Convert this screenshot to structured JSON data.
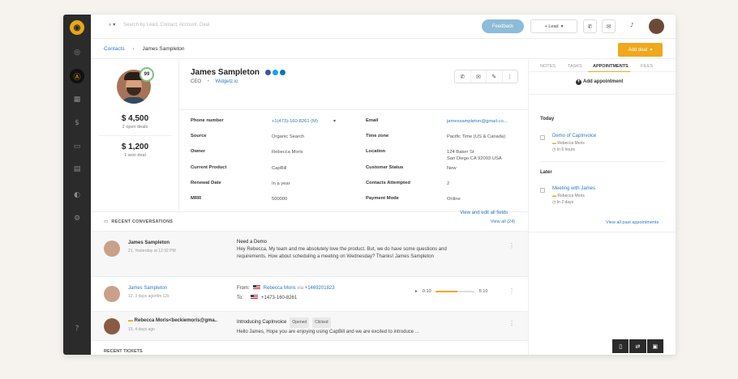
{
  "search": {
    "placeholder": "Search by Lead, Contact, Account, Deal"
  },
  "topbar": {
    "feedback_label": "Feedback",
    "add_lead_label": "+ Lead"
  },
  "breadcrumb": {
    "parent": "Contacts",
    "current": "James Sampleton"
  },
  "add_deal_label": "Add deal",
  "contact": {
    "score": "99",
    "revenue": "$ 4,500",
    "open_deals": "2 open deals",
    "won": "$ 1,200",
    "won_deals": "1 won deal",
    "name": "James Sampleton",
    "role": "CEO",
    "company": "Widgetz.io"
  },
  "fields_left": [
    {
      "label": "Phone number",
      "value": "+1(473)-160-8261 (M)"
    },
    {
      "label": "Source",
      "value": "Organic Search"
    },
    {
      "label": "Owner",
      "value": "Rebecca Moris"
    },
    {
      "label": "Current Product",
      "value": "CapBill"
    },
    {
      "label": "Renewal Date",
      "value": "In a year"
    },
    {
      "label": "MRR",
      "value": "500000"
    }
  ],
  "fields_right": [
    {
      "label": "Email",
      "value": "jamessampleton@gmail.co..."
    },
    {
      "label": "Time zone",
      "value": "Pacific Time (US & Canada)"
    },
    {
      "label": "Location",
      "value": "124 Baker St",
      "value2": "San Diego CA 92093 USA"
    },
    {
      "label": "Customer Status",
      "value": "New"
    },
    {
      "label": "Contacts Attempted",
      "value": "2"
    },
    {
      "label": "Payment Mode",
      "value": "Online"
    }
  ],
  "view_all_fields": "View and edit all fields",
  "conversations": {
    "title": "RECENT CONVERSATIONS",
    "view_all": "View all (24)",
    "items": [
      {
        "name": "James Sampleton",
        "time": "21, Yesterday at 12:32 PM",
        "subject": "Need a Demo",
        "body": "Hey Rebecca, My team and me absolutely love the product. But, we do have some questions and requirements. How about scheduling a meeting on Wednesday? Thanks! James Sampleton"
      },
      {
        "name": "James Sampleton",
        "time": "12, 3 days ago/4m 12s",
        "from_label": "From:",
        "from_name": "Rebecca Moris",
        "via": "via",
        "from_num": "+1469201823",
        "to_label": "To:",
        "to_num": "+1473-160-8261",
        "t_start": "0:10",
        "t_end": "5:10",
        "progress": 0.55
      },
      {
        "name": "Rebecca Moris<beckiemoris@gma..",
        "time": "15, 4 days ago",
        "subject": "Introducing CapInvoice",
        "tag1": "Opened",
        "tag2": "Clicked",
        "body": "Hello James, Hope you are enjoying using CapBill and we are excited to introduce ..."
      }
    ]
  },
  "recent_tickets": "RECENT TICKETS",
  "right_panel": {
    "tabs": [
      "NOTES",
      "TASKS",
      "APPOINTMENTS",
      "FILES"
    ],
    "add_appointment": "Add appointment",
    "today": "Today",
    "later": "Later",
    "appt1": {
      "title": "Demo of CapInvoice",
      "owner": "Rebecca Moris",
      "when": "In 6 hours"
    },
    "appt2": {
      "title": "Meeting with James",
      "owner": "Rebecca Moris",
      "when": "In 2 days"
    },
    "past_link": "View all past appointments"
  },
  "colors": {
    "accent": "#f0a81c",
    "link": "#2e7ab8",
    "sidebar": "#2b2b2b",
    "feedback": "#8dbcd8"
  },
  "icons": {
    "sidebar": [
      "target-icon",
      "dollar-icon",
      "building-icon",
      "money-icon",
      "chat-icon",
      "calendar-icon",
      "chart-icon",
      "settings-icon",
      "help-icon"
    ]
  }
}
